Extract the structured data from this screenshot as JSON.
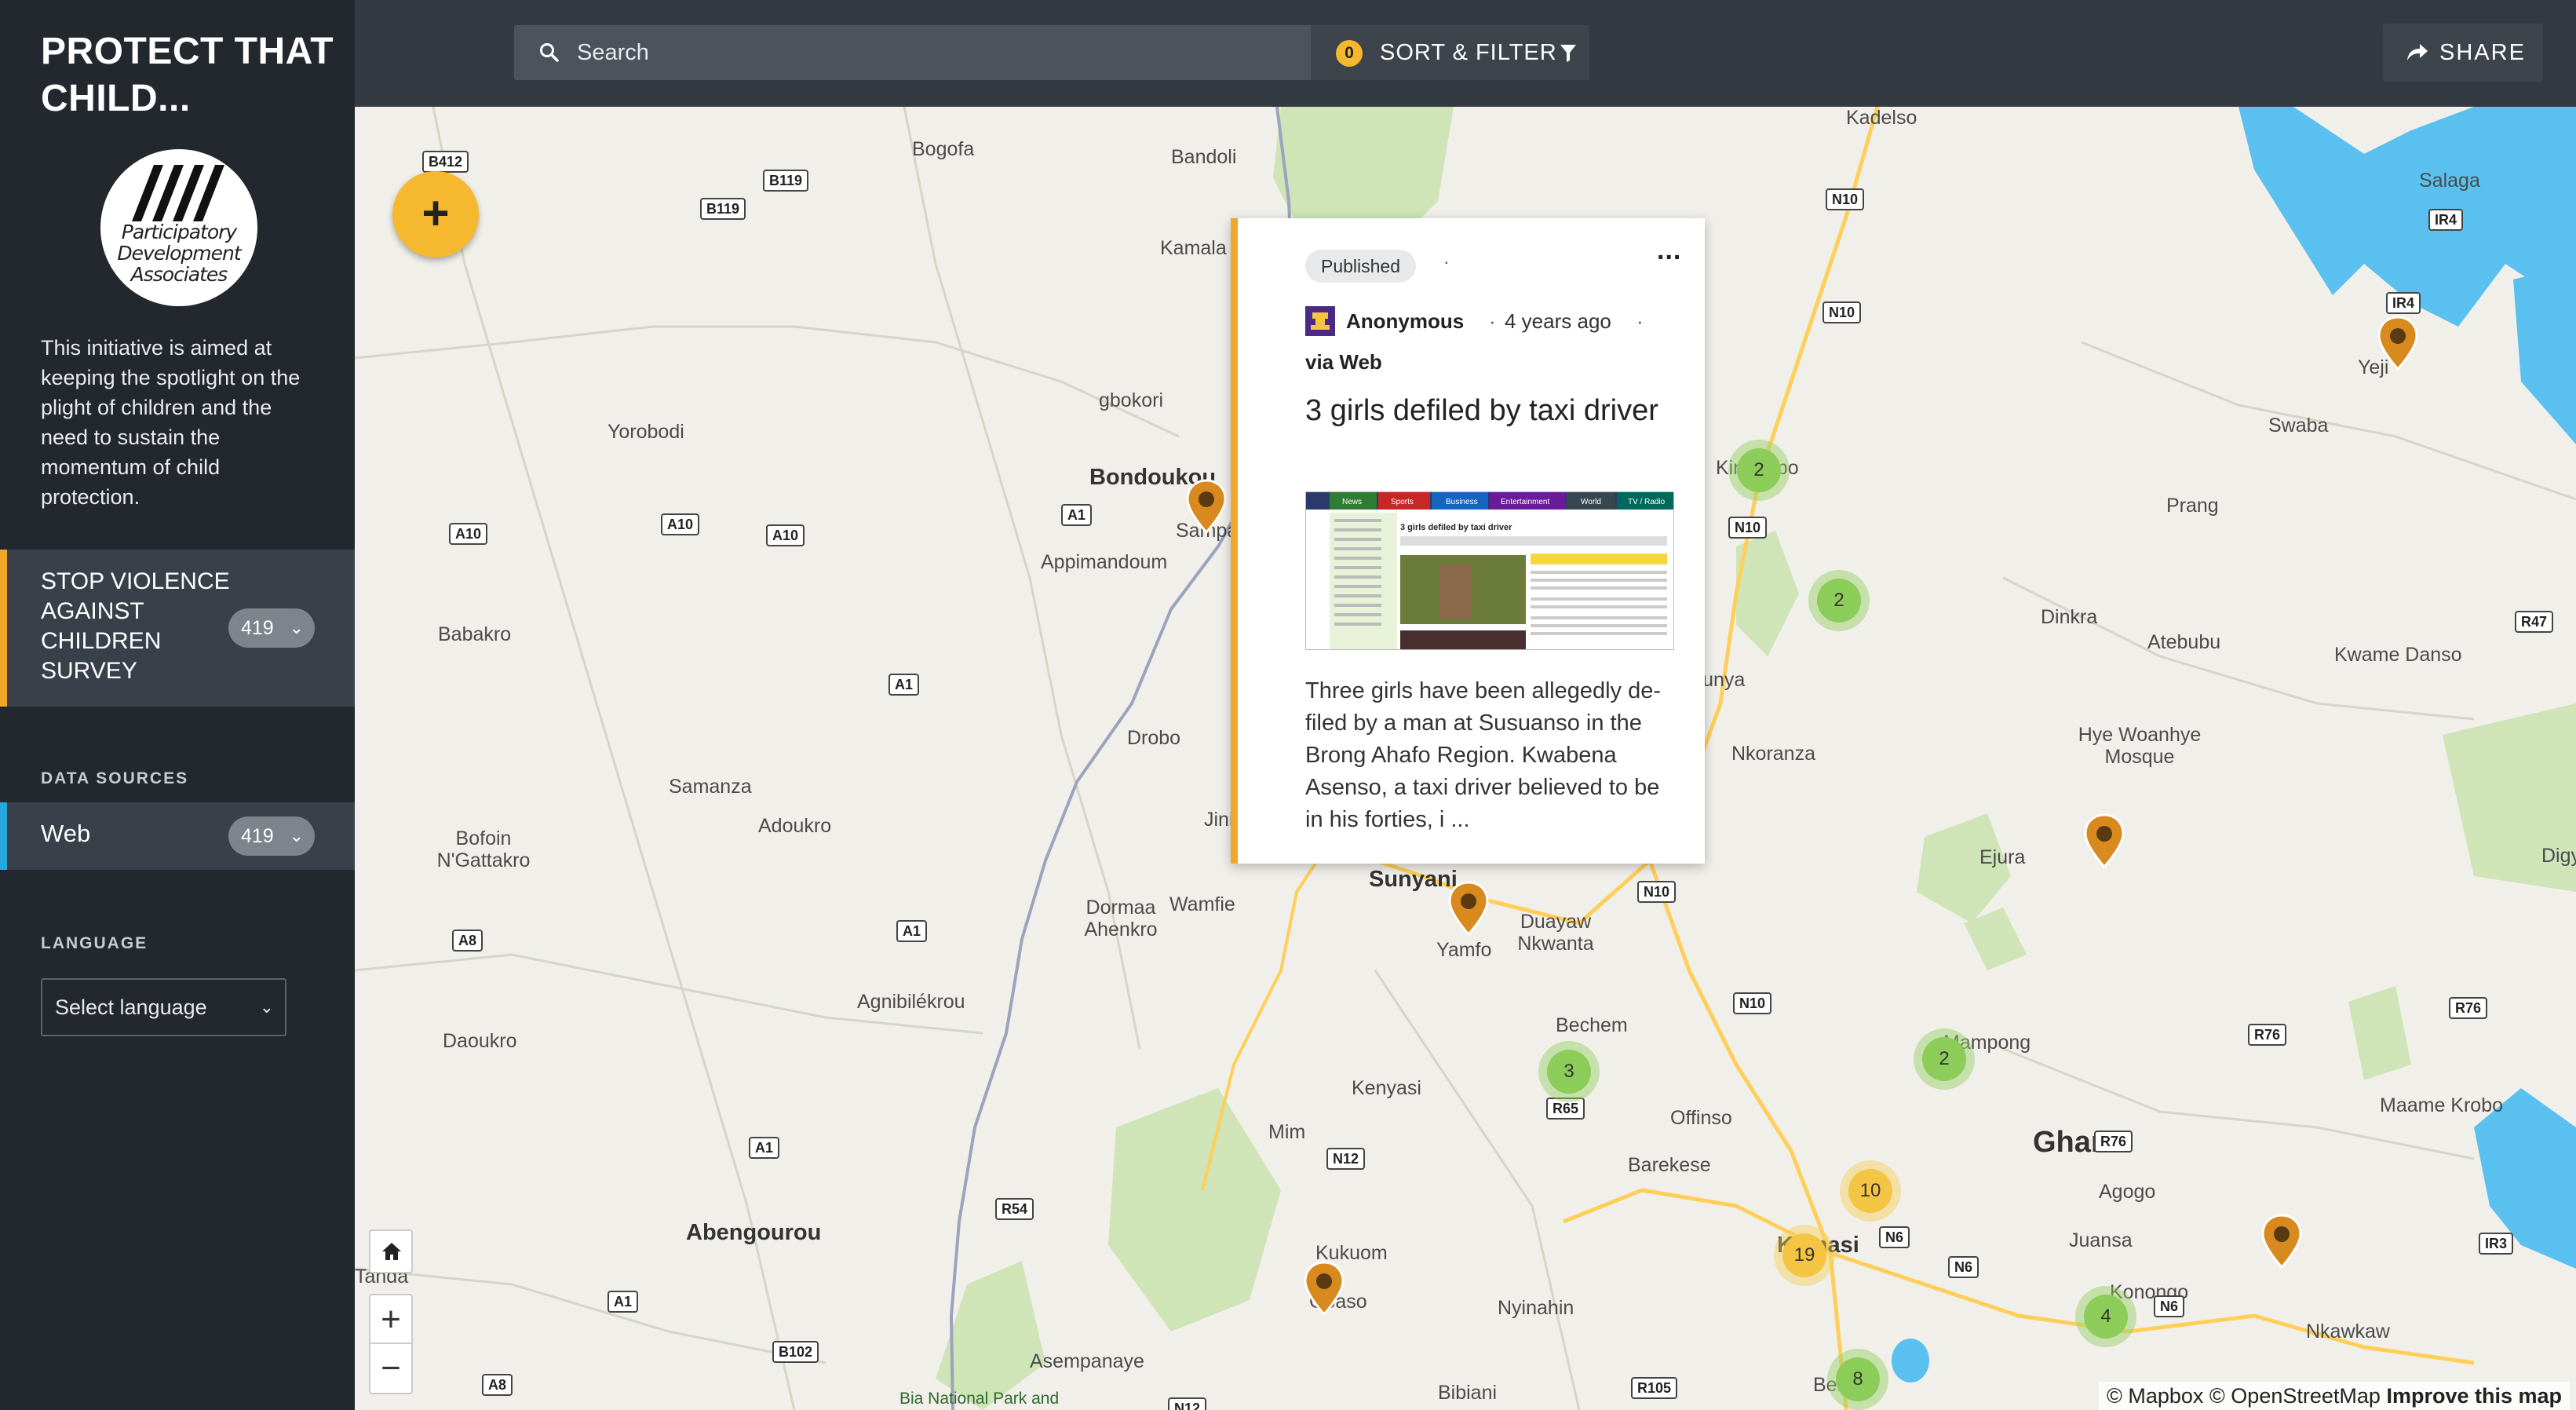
{
  "sidebar": {
    "title": "PROTECT THAT CHILD...",
    "logo_lines": [
      "Participatory",
      "Development",
      "Associates"
    ],
    "description": "This initiative is aimed at keeping the spotlight on the plight of children and the need to sustain the momentum of child protection.",
    "survey": {
      "label": "STOP VIOLENCE AGAINST CHILDREN SURVEY",
      "count": "419"
    },
    "data_sources_heading": "DATA SOURCES",
    "source": {
      "label": "Web",
      "count": "419"
    },
    "language_heading": "LANGUAGE",
    "language_select": "Select language"
  },
  "topbar": {
    "search_placeholder": "Search",
    "filter_count": "0",
    "sort_filter_label": "SORT & FILTER",
    "share_label": "SHARE"
  },
  "map": {
    "add_label": "+",
    "zoom_in": "+",
    "zoom_out": "−",
    "attribution": "© Mapbox © OpenStreetMap",
    "improve": "Improve this map",
    "places": [
      "Bogofa",
      "Bandoli",
      "Kadelso",
      "Salaga",
      "Kamala",
      "Yeji",
      "Swaba",
      "gbokori",
      "Yorobodi",
      "Bondoukou",
      "Sampa",
      "Kintampo",
      "Prang",
      "Appimandoum",
      "Babakro",
      "Dinkra",
      "Atebubu",
      "Kwame Danso",
      "Busunya",
      "Drobo",
      "Hye Woanhye Mosque",
      "Nkoranza",
      "Samanza",
      "Adoukro",
      "Ejura",
      "Bofoin N'Gattakro",
      "Jinijini",
      "Sunyani",
      "Digya",
      "Dormaa Ahenkro",
      "Wamfie",
      "Yamfo",
      "Duayaw Nkwanta",
      "Agnibilékrou",
      "Bechem",
      "Mampong",
      "Daoukro",
      "Kenyasi",
      "Offinso",
      "Ghana",
      "Maame Krobo",
      "Mim",
      "Barekese",
      "Agogo",
      "Abengourou",
      "Kukuom",
      "Kumasi",
      "Juansa",
      "Konongo",
      "Goaso",
      "Nyinahin",
      "Nkawkaw",
      "Asempanaye",
      "Bia National Park and",
      "Bibiani",
      "Bekwai",
      "Tanda"
    ],
    "roads": [
      "B412",
      "B119",
      "B119",
      "N10",
      "N10",
      "IR4",
      "IR4",
      "A10",
      "A10",
      "A10",
      "A1",
      "N10",
      "R47",
      "A1",
      "A8",
      "A1",
      "N10",
      "R76",
      "R76",
      "A1",
      "N10",
      "N12",
      "R65",
      "R76",
      "R54",
      "N6",
      "N6",
      "N6",
      "IR3",
      "A1",
      "B102",
      "A8",
      "R105",
      "N12"
    ],
    "clusters": [
      "2",
      "2",
      "3",
      "2",
      "10",
      "19",
      "4",
      "8"
    ]
  },
  "post": {
    "status": "Published",
    "more": "...",
    "author": "Anonymous",
    "time_ago": "4 years ago",
    "source": "via Web",
    "title": "3 girls defiled by taxi driver",
    "body": "Three girls have been allegedly de-filed by a man at Susuanso in the Brong Ahafo Region. Kwabena Asenso, a taxi driver believed to be in his forties, i ...",
    "thumbnail": {
      "nav": [
        "News",
        "Sports",
        "Business",
        "Entertainment",
        "World",
        "TV / Radio"
      ],
      "headline": "3 girls defiled by taxi driver"
    }
  },
  "colors": {
    "accent": "#f0a72a",
    "sidebar": "#23282f",
    "topbar": "#343a42",
    "source_accent": "#28a7dd",
    "cluster_green": "#8ccc58",
    "cluster_yellow": "#f4c542",
    "water": "#5ac0ef"
  }
}
